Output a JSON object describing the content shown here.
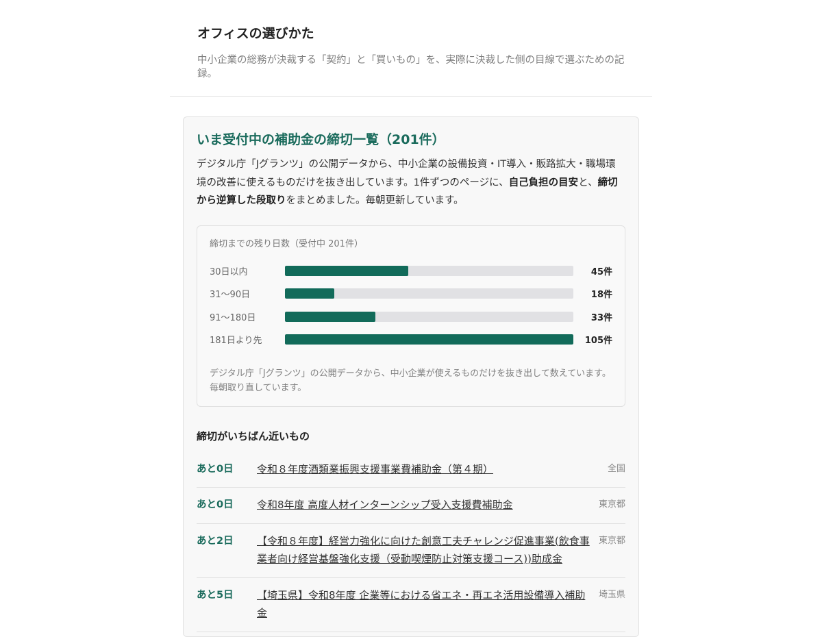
{
  "header": {
    "title": "オフィスの選びかた",
    "tagline": "中小企業の総務が決裁する「契約」と「買いもの」を、実際に決裁した側の目線で選ぶための記録。"
  },
  "card": {
    "title": "いま受付中の補助金の締切一覧（201件）",
    "desc_part1": "デジタル庁「Jグランツ」の公開データから、中小企業の設備投資・IT導入・販路拡大・職場環境の改善に使えるものだけを抜き出しています。1件ずつのページに、",
    "desc_bold1": "自己負担の目安",
    "desc_part2": "と、",
    "desc_bold2": "締切から逆算した段取り",
    "desc_part3": "をまとめました。毎朝更新しています。"
  },
  "chart": {
    "caption": "締切までの残り日数（受付中 201件）",
    "note": "デジタル庁「Jグランツ」の公開データから、中小企業が使えるものだけを抜き出して数えています。毎朝取り直しています。",
    "bar_color": "#126b5a",
    "track_color": "#e1e1e4"
  },
  "chart_data": {
    "type": "bar",
    "orientation": "horizontal",
    "title": "締切までの残り日数（受付中 201件）",
    "categories": [
      "30日以内",
      "31〜90日",
      "91〜180日",
      "181日より先"
    ],
    "values": [
      45,
      18,
      33,
      105
    ],
    "value_labels": [
      "45件",
      "18件",
      "33件",
      "105件"
    ],
    "xlim": [
      0,
      105
    ]
  },
  "deadlines": {
    "heading": "締切がいちばん近いもの",
    "items": [
      {
        "days": "あと0日",
        "title": "令和８年度酒類業振興支援事業費補助金（第４期）",
        "region": "全国"
      },
      {
        "days": "あと0日",
        "title": "令和8年度 高度人材インターンシップ受入支援費補助金",
        "region": "東京都"
      },
      {
        "days": "あと2日",
        "title": "【令和８年度】経営力強化に向けた創意工夫チャレンジ促進事業(飲食事業者向け経営基盤強化支援（受動喫煙防止対策支援コース))助成金",
        "region": "東京都"
      },
      {
        "days": "あと5日",
        "title": "【埼玉県】令和8年度 企業等における省エネ・再エネ活用設備導入補助金",
        "region": "埼玉県"
      }
    ]
  }
}
